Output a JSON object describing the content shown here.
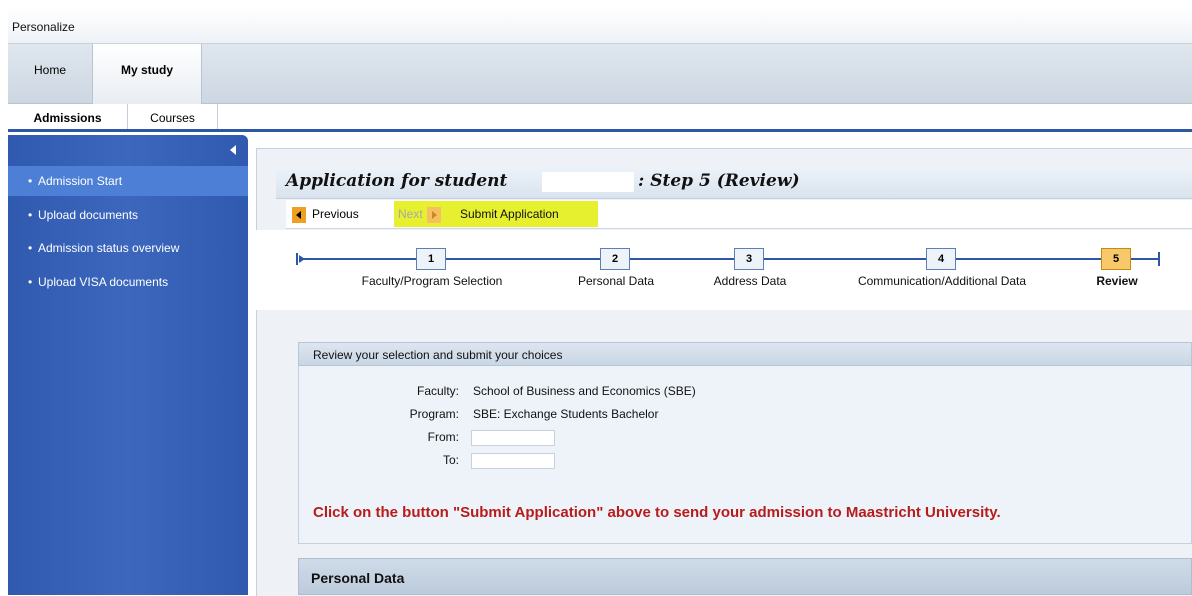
{
  "header": {
    "personalize": "Personalize"
  },
  "top_tabs": {
    "home": "Home",
    "my_study": "My study"
  },
  "sub_tabs": {
    "admissions": "Admissions",
    "courses": "Courses"
  },
  "sidebar": {
    "items": [
      {
        "label": "Admission Start"
      },
      {
        "label": "Upload documents"
      },
      {
        "label": "Admission status overview"
      },
      {
        "label": "Upload VISA documents"
      }
    ]
  },
  "page": {
    "title_prefix": "Application for student",
    "title_suffix": ": Step 5  (Review)"
  },
  "toolbar": {
    "previous": "Previous",
    "next": "Next",
    "submit": "Submit Application"
  },
  "roadmap": {
    "steps": [
      {
        "number": "1",
        "label": "Faculty/Program Selection"
      },
      {
        "number": "2",
        "label": "Personal Data"
      },
      {
        "number": "3",
        "label": "Address Data"
      },
      {
        "number": "4",
        "label": "Communication/Additional Data"
      },
      {
        "number": "5",
        "label": "Review"
      }
    ]
  },
  "review": {
    "heading": "Review your selection and submit your choices",
    "faculty_label": "Faculty:",
    "faculty_value": "School of Business and Economics (SBE)",
    "program_label": "Program:",
    "program_value": "SBE: Exchange Students Bachelor",
    "from_label": "From:",
    "to_label": "To:",
    "note": "Click on the button \"Submit Application\" above to send your admission to Maastricht University."
  },
  "personal_section": {
    "heading": "Personal Data"
  },
  "colors": {
    "sidebar": "#3c67bd",
    "highlight": "#e6f02f",
    "note_red": "#b71c1c"
  }
}
